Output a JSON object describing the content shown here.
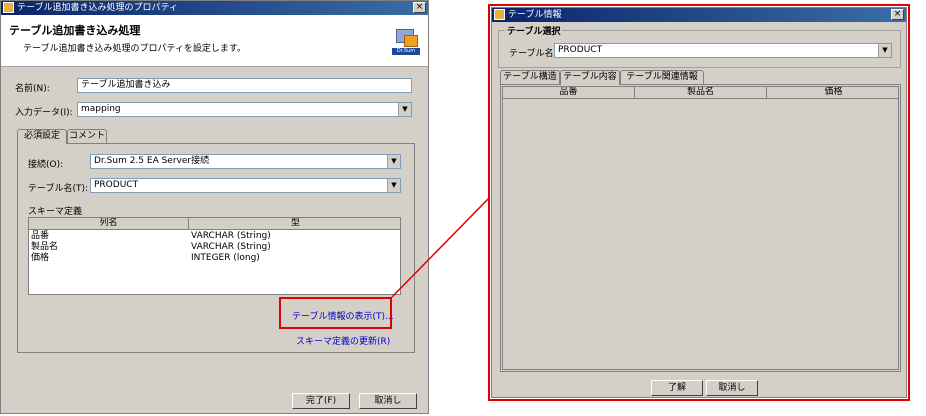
{
  "window1": {
    "title": "テーブル追加書き込み処理のプロパティ",
    "close_label": "×",
    "header_title": "テーブル追加書き込み処理",
    "header_desc": "テーブル追加書き込み処理のプロパティを設定します。",
    "logo_text": "Dr.Sum",
    "name_label": "名前(N):",
    "name_value": "テーブル追加書き込み",
    "input_data_label": "入力データ(I):",
    "input_data_value": "mapping",
    "tabs": [
      "必須設定",
      "コメント"
    ],
    "connection_label": "接続(O):",
    "connection_value": "Dr.Sum 2.5 EA Server接続",
    "table_name_label": "テーブル名(T):",
    "table_name_value": "PRODUCT",
    "schema_label": "スキーマ定義",
    "schema_columns": [
      "列名",
      "型"
    ],
    "schema_rows": [
      {
        "name": "品番",
        "type": "VARCHAR (String)"
      },
      {
        "name": "製品名",
        "type": "VARCHAR (String)"
      },
      {
        "name": "価格",
        "type": "INTEGER (long)"
      }
    ],
    "show_table_info_link": "テーブル情報の表示(T)...",
    "update_schema_link": "スキーマ定義の更新(R)",
    "finish_button": "完了(F)",
    "cancel_button": "取消し"
  },
  "window2": {
    "title": "テーブル情報",
    "close_label": "×",
    "group_title": "テーブル選択",
    "table_name_label": "テーブル名",
    "table_name_value": "PRODUCT",
    "tabs": [
      "テーブル構造",
      "テーブル内容",
      "テーブル関連情報"
    ],
    "columns": [
      "品番",
      "製品名",
      "価格"
    ],
    "ok_button": "了解",
    "cancel_button": "取消し"
  },
  "colors": {
    "highlight": "#e00000",
    "dialog_bg": "#d4d0c8",
    "link": "#0000cc",
    "titlebar": "#0a246a"
  }
}
